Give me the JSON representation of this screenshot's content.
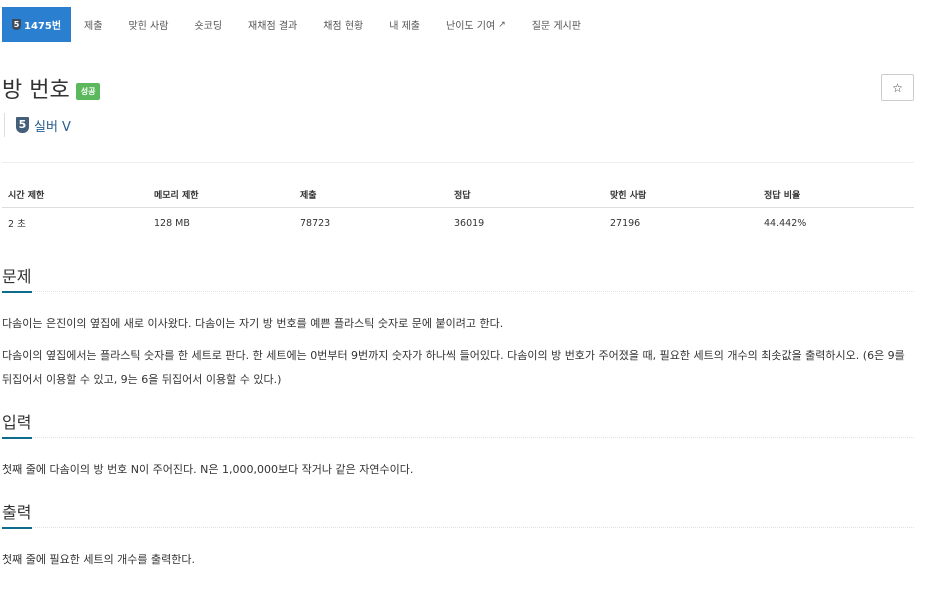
{
  "nav": {
    "problem_id": "1475번",
    "tier_digit": "5",
    "items": [
      "제출",
      "맞힌 사람",
      "숏코딩",
      "재채점 결과",
      "채점 현황",
      "내 제출",
      "난이도 기여",
      "질문 게시판"
    ],
    "external_icon": "external-link-icon"
  },
  "problem": {
    "title": "방 번호",
    "status_badge": "성공",
    "star": "☆",
    "tier_digit": "5",
    "tier_label": "실버 V"
  },
  "stats": {
    "headers": [
      "시간 제한",
      "메모리 제한",
      "제출",
      "정답",
      "맞힌 사람",
      "정답 비율"
    ],
    "values": [
      "2 초",
      "128 MB",
      "78723",
      "36019",
      "27196",
      "44.442%"
    ]
  },
  "sections": {
    "problem": {
      "title": "문제",
      "paragraphs": [
        "다솜이는 은진이의 옆집에 새로 이사왔다. 다솜이는 자기 방 번호를 예쁜 플라스틱 숫자로 문에 붙이려고 한다.",
        "다솜이의 옆집에서는 플라스틱 숫자를 한 세트로 판다. 한 세트에는 0번부터 9번까지 숫자가 하나씩 들어있다. 다솜이의 방 번호가 주어졌을 때, 필요한 세트의 개수의 최솟값을 출력하시오. (6은 9를 뒤집어서 이용할 수 있고, 9는 6을 뒤집어서 이용할 수 있다.)"
      ]
    },
    "input": {
      "title": "입력",
      "paragraphs": [
        "첫째 줄에 다솜이의 방 번호 N이 주어진다. N은 1,000,000보다 작거나 같은 자연수이다."
      ]
    },
    "output": {
      "title": "출력",
      "paragraphs": [
        "첫째 줄에 필요한 세트의 개수를 출력한다."
      ]
    }
  },
  "colors": {
    "nav_active": "#2a7fd0",
    "success_badge": "#5cb85c",
    "tier_silver": "#435f7a",
    "section_underline": "#0d6b8c"
  }
}
